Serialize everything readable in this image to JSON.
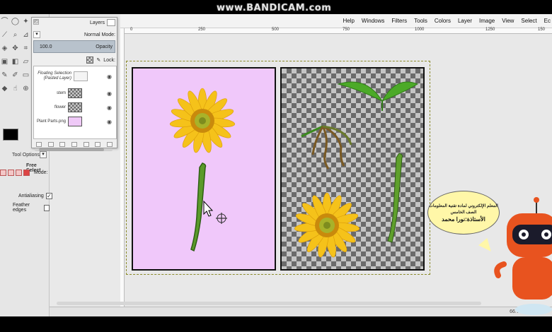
{
  "watermark": "www.BANDICAM.com",
  "menubar": {
    "items": [
      "Help",
      "Windows",
      "Filters",
      "Tools",
      "Colors",
      "Layer",
      "Image",
      "View",
      "Select",
      "Ec"
    ]
  },
  "toolbox": {
    "tools": [
      "lasso-icon",
      "ellipse-select-icon",
      "fuzzy-select-icon",
      "color-picker-icon",
      "zoom-icon",
      "measure-icon",
      "warp-icon",
      "move-icon",
      "crop-icon",
      "transform-icon",
      "flip-icon",
      "perspective-icon",
      "paintbrush-icon",
      "pencil-icon",
      "eraser-icon",
      "bucket-fill-icon",
      "smudge-icon",
      "clone-icon"
    ],
    "fg_color": "#000000",
    "bg_color": "#ffffff"
  },
  "tool_options": {
    "title": "Tool Options",
    "tool_name": "Free Select",
    "mode_label": "Mode:",
    "antialiasing_label": "Antialiasing",
    "antialiasing_checked": "✓",
    "feather_label": "Feather edges"
  },
  "layers_dock": {
    "tab_label": "Layers",
    "mode_label": "Normal",
    "mode_suffix": "Mode:",
    "opacity_value": "100.0",
    "opacity_label": "Opacity",
    "lock_label": "Lock:",
    "layers": [
      {
        "name": "Floating Selection (Pasted Layer)",
        "thumb": "floating"
      },
      {
        "name": "stem",
        "thumb": "checker"
      },
      {
        "name": "flower",
        "thumb": "checker"
      },
      {
        "name": "Plant Parts.png",
        "thumb": "pink"
      }
    ]
  },
  "rulers": {
    "top_ticks": [
      "0",
      "250",
      "500",
      "750",
      "1000",
      "1250",
      "150"
    ]
  },
  "canvas": {
    "left_bg": "#f0c8fa",
    "flower_color": "#f5c21a",
    "stem_color": "#5a9a2a"
  },
  "bubble": {
    "line1": "المعلم الإلكتروني لمادة تقنية المعلومات",
    "line2": "الصف الخامس",
    "line3": "الأستاذة:نورا محمد"
  },
  "statusbar": {
    "zoom": "66.7%"
  }
}
